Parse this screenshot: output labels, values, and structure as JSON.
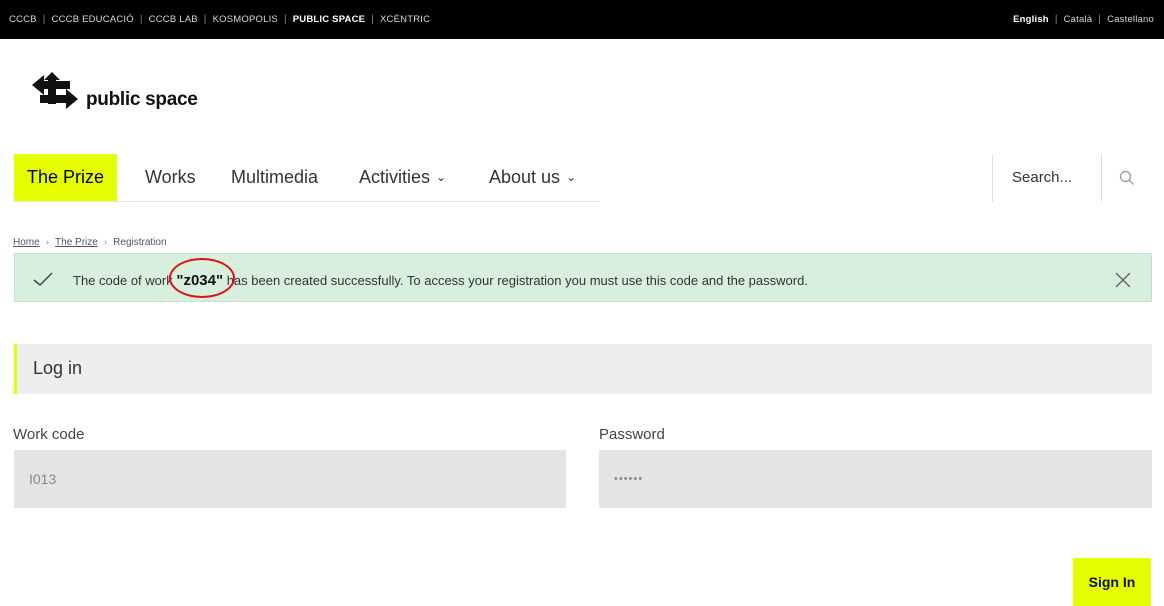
{
  "topbar": {
    "left_links": [
      "CCCB",
      "CCCB EDUCACIÓ",
      "CCCB LAB",
      "KOSMOPOLIS",
      "PUBLIC SPACE",
      "XCÈNTRIC"
    ],
    "active_left": "PUBLIC SPACE",
    "languages": [
      "English",
      "Català",
      "Castellano"
    ],
    "active_language": "English"
  },
  "logo": {
    "text": "public space"
  },
  "nav": {
    "items": [
      {
        "label": "The Prize",
        "active": true
      },
      {
        "label": "Works"
      },
      {
        "label": "Multimedia"
      },
      {
        "label": "Activities",
        "dropdown": true
      },
      {
        "label": "About us",
        "dropdown": true
      }
    ],
    "search_placeholder": "Search..."
  },
  "breadcrumb": {
    "home": "Home",
    "prize": "The Prize",
    "current": "Registration"
  },
  "alert": {
    "prefix": "The code of work ",
    "code": "\"z034\"",
    "suffix": " has been created successfully. To access your registration you must use this code and the password."
  },
  "login": {
    "title": "Log in",
    "work_code_label": "Work code",
    "work_code_value": "I013",
    "password_label": "Password",
    "password_value": "••••••",
    "submit_label": "Sign In"
  },
  "colors": {
    "accent": "#e6ff00",
    "alert_bg": "#d8efde",
    "annotation": "#e01010"
  }
}
